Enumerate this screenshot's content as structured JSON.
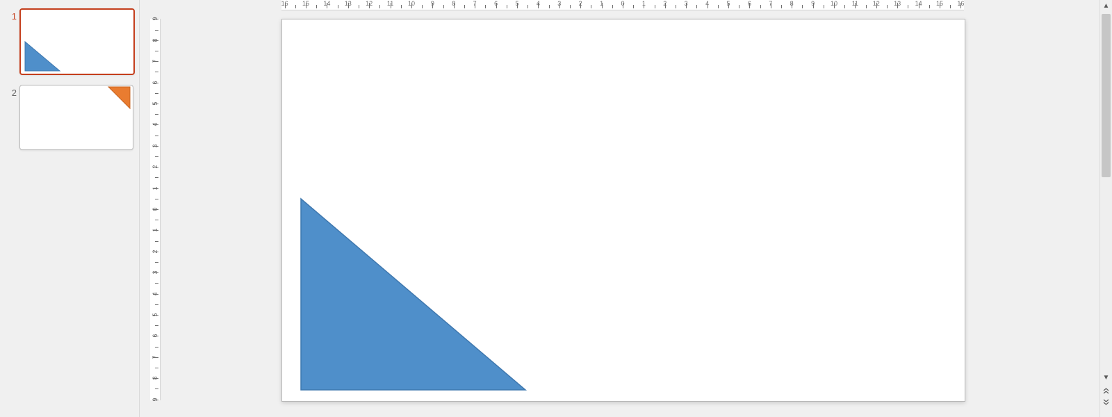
{
  "ruler": {
    "h": {
      "min": -16,
      "max": 16,
      "originX": 896,
      "pxPerUnit": 30.4,
      "leftEdge": 405,
      "rightEdge": 1387
    },
    "v": {
      "min": -9,
      "max": 9,
      "originY": 301,
      "pxPerUnit": 30.4,
      "topEdge": 27,
      "bottomEdge": 576
    }
  },
  "slides": [
    {
      "number": "1",
      "active": true,
      "shape": {
        "type": "right-triangle",
        "fill": "#4f8fca",
        "stroke": "#3f78af"
      }
    },
    {
      "number": "2",
      "active": false,
      "shape": {
        "type": "corner-triangle",
        "fill": "#e97c30",
        "stroke": "#c86522"
      }
    }
  ],
  "canvas": {
    "slideLeft": 405,
    "slideTop": 27,
    "slideWidth": 982,
    "slideHeight": 549,
    "currentSlide": 0
  },
  "scrollbar": {
    "thumbTop": 20,
    "thumbHeight": 235
  },
  "colors": {
    "selected": "#c43e1c",
    "blue": "#4f8fca",
    "orange": "#e97c30"
  }
}
